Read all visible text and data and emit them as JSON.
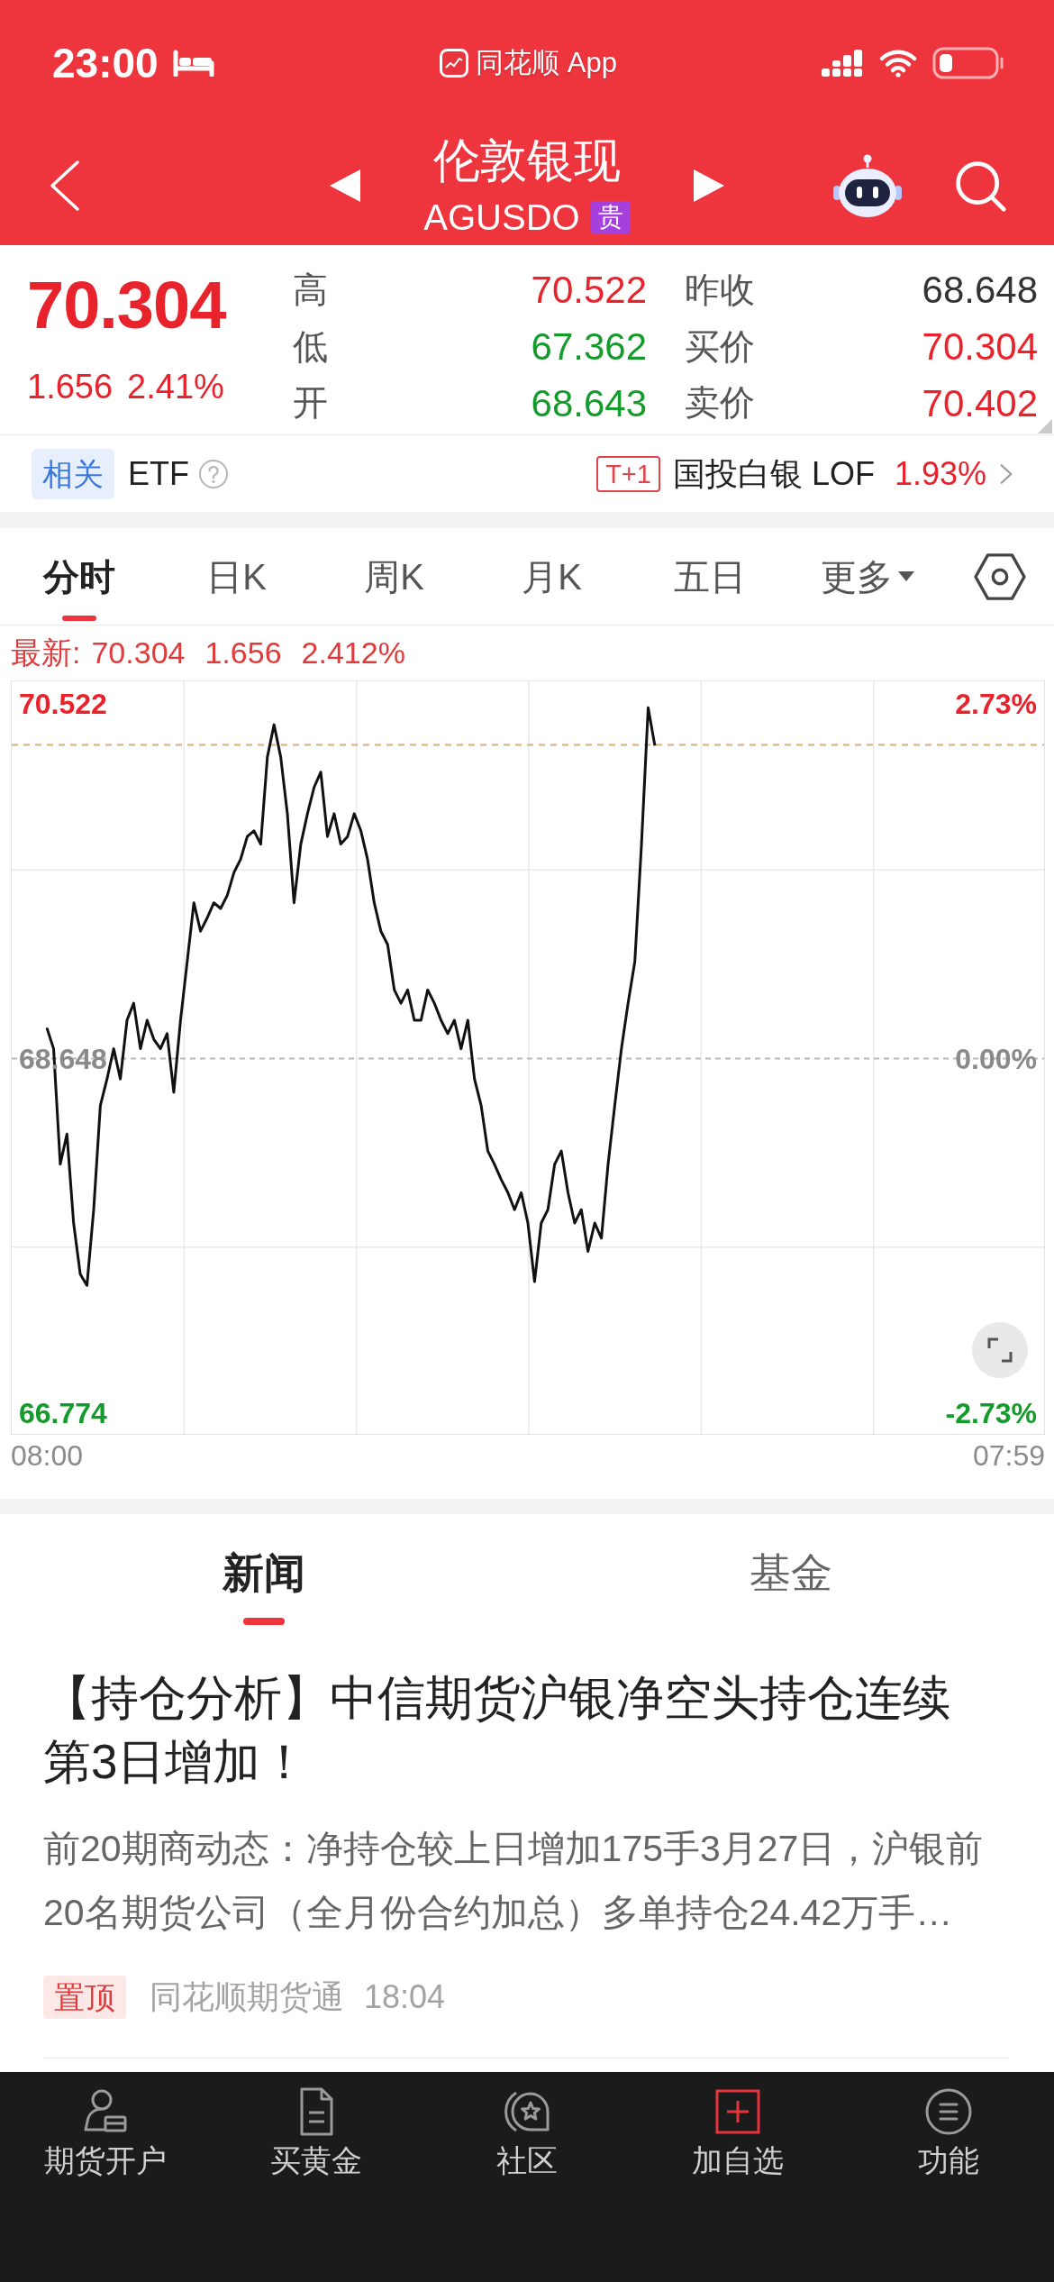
{
  "status_bar": {
    "time": "23:00",
    "back_app": "同花顺 App"
  },
  "header": {
    "title": "伦敦银现",
    "code": "AGUSDO",
    "tag": "贵"
  },
  "quote": {
    "price": "70.304",
    "change": "1.656",
    "change_pct": "2.41%",
    "color": "#e8232b",
    "fields": [
      {
        "label": "高",
        "value": "70.522",
        "color": "#e8232b"
      },
      {
        "label": "昨收",
        "value": "68.648",
        "color": "#333333"
      },
      {
        "label": "低",
        "value": "67.362",
        "color": "#159a2c"
      },
      {
        "label": "买价",
        "value": "70.304",
        "color": "#e8232b"
      },
      {
        "label": "开",
        "value": "68.643",
        "color": "#159a2c"
      },
      {
        "label": "卖价",
        "value": "70.402",
        "color": "#e8232b"
      }
    ]
  },
  "related": {
    "tag": "相关",
    "label": "ETF",
    "fund": {
      "tag": "T+1",
      "name": "国投白银 LOF",
      "change": "1.93%",
      "color": "#e8232b"
    }
  },
  "chart_tabs": [
    {
      "label": "分时",
      "kind": "plain",
      "selected": true
    },
    {
      "label": "日K",
      "kind": "plain",
      "selected": false
    },
    {
      "label": "周K",
      "kind": "plain",
      "selected": false
    },
    {
      "label": "月K",
      "kind": "plain",
      "selected": false
    },
    {
      "label": "五日",
      "kind": "plain",
      "selected": false
    },
    {
      "label": "更多",
      "kind": "dropdown",
      "selected": false
    }
  ],
  "latest": {
    "label": "最新:",
    "price": "70.304",
    "change": "1.656",
    "change_pct": "2.412%",
    "color": "#e03a3a"
  },
  "chart": {
    "right_ticks": [
      "2.73%",
      "0.00%",
      "-2.73%"
    ],
    "chart_data": {
      "type": "line",
      "categories": [
        "08:00",
        null,
        null,
        null,
        null,
        null,
        null,
        null,
        null,
        null,
        null,
        null,
        null,
        null,
        null,
        null,
        null,
        null,
        null,
        null,
        null,
        null,
        null,
        null,
        null,
        null,
        null,
        null,
        null,
        null,
        null,
        null,
        null,
        null,
        null,
        null,
        null,
        null,
        null,
        null,
        null,
        null,
        null,
        null,
        null,
        null,
        null,
        null,
        null,
        null,
        null,
        null,
        null,
        null,
        null,
        null,
        null,
        null,
        null,
        null,
        null,
        null,
        null,
        null,
        null,
        null,
        null,
        null,
        null,
        null,
        null,
        null,
        null,
        null,
        null,
        null,
        null,
        null,
        null,
        null,
        null,
        null,
        null,
        null,
        null,
        null,
        null,
        null,
        null,
        null,
        null,
        null,
        null,
        null,
        null,
        null,
        null,
        null,
        null,
        null,
        null,
        null,
        null,
        null,
        null,
        null,
        null,
        null,
        null,
        null,
        null,
        null,
        null,
        null,
        null,
        null,
        null,
        null,
        null,
        null,
        null,
        null,
        null,
        null,
        null,
        null,
        null,
        null,
        null,
        null,
        null,
        null,
        null,
        null,
        null,
        null,
        null,
        null,
        null,
        null,
        null,
        null,
        null,
        null,
        "07:59"
      ],
      "ylim": [
        66.657,
        70.639
      ],
      "yticks": [
        {
          "value": 70.522,
          "label": "70.522"
        },
        {
          "value": 68.648,
          "label": "68.648"
        },
        {
          "value": 66.774,
          "label": "66.774"
        }
      ],
      "series": [
        {
          "color": "#111111",
          "values": [
            68.81,
            68.7,
            68.09,
            68.25,
            67.78,
            67.51,
            67.45,
            67.85,
            68.4,
            68.54,
            68.7,
            68.54,
            68.85,
            68.94,
            68.7,
            68.85,
            68.75,
            68.7,
            68.78,
            68.47,
            68.85,
            69.16,
            69.47,
            69.32,
            69.39,
            69.47,
            69.44,
            69.51,
            69.63,
            69.7,
            69.82,
            69.85,
            69.78,
            70.24,
            70.41,
            70.24,
            69.94,
            69.47,
            69.78,
            69.94,
            70.08,
            70.16,
            69.82,
            69.94,
            69.78,
            69.82,
            69.94,
            69.85,
            69.7,
            69.47,
            69.32,
            69.25,
            69.01,
            68.94,
            69.01,
            68.85,
            68.85,
            69.01,
            68.94,
            68.85,
            68.78,
            68.85,
            68.7,
            68.85,
            68.54,
            68.4,
            68.16,
            68.09,
            68.01,
            67.94,
            67.85,
            67.94,
            67.78,
            67.47,
            67.78,
            67.85,
            68.09,
            68.16,
            67.94,
            67.78,
            67.85,
            67.63,
            67.78,
            67.7,
            68.09,
            68.4,
            68.7,
            68.94,
            69.16,
            69.78,
            70.5,
            70.3,
            null,
            null,
            null,
            null,
            null,
            null,
            null,
            null,
            null,
            null,
            null,
            null,
            null,
            null,
            null,
            null,
            null,
            null,
            null,
            null,
            null,
            null,
            null,
            null,
            null,
            null,
            null,
            null,
            null,
            null,
            null,
            null,
            null,
            null,
            null,
            null,
            null,
            null,
            null,
            null,
            null,
            null,
            null,
            null,
            null,
            null,
            null,
            null,
            null,
            null,
            null,
            null,
            null
          ]
        }
      ],
      "ref_lines": [
        {
          "axis": "y",
          "value": 70.304
        },
        {
          "axis": "y",
          "value": 68.648
        }
      ]
    }
  },
  "news_tabs": [
    {
      "label": "新闻",
      "selected": true
    },
    {
      "label": "基金",
      "selected": false
    }
  ],
  "articles": [
    {
      "title": "【持仓分析】中信期货沪银净空头持仓连续第3日增加！",
      "summary": "前20期商动态：净持仓较上日增加175手3月27日，沪银前20名期货公司（全月份合约加总）多单持仓24.42万手…",
      "tag": "置顶",
      "source": "同花顺期货通",
      "time": "18:04"
    }
  ],
  "bottom_nav": [
    {
      "label": "期货开户"
    },
    {
      "label": "买黄金"
    },
    {
      "label": "社区"
    },
    {
      "label": "加自选"
    },
    {
      "label": "功能"
    }
  ]
}
